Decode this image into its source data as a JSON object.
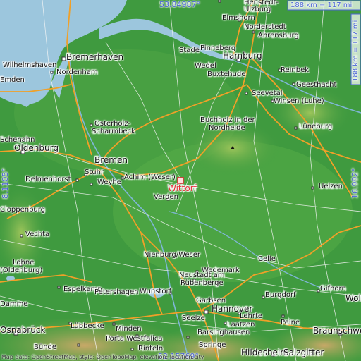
{
  "map": {
    "coords": {
      "top_lat": "53.84987°",
      "bottom_lat": "52.15769°",
      "left_lon": "8.1105°",
      "right_lon": "10.992°",
      "scale_h": "188 km = 117 mi",
      "scale_v": "188 km = 117 mi"
    },
    "highlight": {
      "name": "Wittorf"
    },
    "places": [
      {
        "name": "Elmshorn"
      },
      {
        "name": "Ulzburg"
      },
      {
        "name": "Henstedt-"
      },
      {
        "name": "Norderstedt"
      },
      {
        "name": "Ahrensburg"
      },
      {
        "name": "Stade"
      },
      {
        "name": "Pinneberg"
      },
      {
        "name": "Hamburg"
      },
      {
        "name": "Bremerhaven"
      },
      {
        "name": "Wilhelmshaven"
      },
      {
        "name": "Nordenham"
      },
      {
        "name": "Wedel"
      },
      {
        "name": "Buxtehude"
      },
      {
        "name": "Reinbek"
      },
      {
        "name": "Geesthacht"
      },
      {
        "name": "Seevetal"
      },
      {
        "name": "Winsen (Luhe)"
      },
      {
        "name": "Osterholz-"
      },
      {
        "name": "Scharmbeck"
      },
      {
        "name": "Buchholz in der"
      },
      {
        "name": "Nordheide"
      },
      {
        "name": "Lüneburg"
      },
      {
        "name": "Oldenburg"
      },
      {
        "name": "Bremen"
      },
      {
        "name": "Stuhr"
      },
      {
        "name": "Delmenhorst"
      },
      {
        "name": "Weyhe"
      },
      {
        "name": "Achim (Weser)"
      },
      {
        "name": "Uelzen"
      },
      {
        "name": "Verden"
      },
      {
        "name": "Vechta"
      },
      {
        "name": "Nienburg/Weser"
      },
      {
        "name": "Celle"
      },
      {
        "name": "Wedemark"
      },
      {
        "name": "Neustadt am"
      },
      {
        "name": "Rübenberge"
      },
      {
        "name": "Lohne"
      },
      {
        "name": "(Oldenburg)"
      },
      {
        "name": "Espelkamp"
      },
      {
        "name": "Petershagen"
      },
      {
        "name": "Wunstorf"
      },
      {
        "name": "Garbsen"
      },
      {
        "name": "Hannover"
      },
      {
        "name": "Burgdorf"
      },
      {
        "name": "Gifhorn"
      },
      {
        "name": "Wolfsburg"
      },
      {
        "name": "Lübbecke"
      },
      {
        "name": "Minden"
      },
      {
        "name": "Seelze"
      },
      {
        "name": "Lehrte"
      },
      {
        "name": "Peine"
      },
      {
        "name": "Osnabrück"
      },
      {
        "name": "Porta Westfalica"
      },
      {
        "name": "Laatzen"
      },
      {
        "name": "Barsinghausen"
      },
      {
        "name": "Springe"
      },
      {
        "name": "Rinteln"
      },
      {
        "name": "Bünde"
      },
      {
        "name": "Hildesheim"
      },
      {
        "name": "Salzgitter"
      },
      {
        "name": "Braunschweig"
      },
      {
        "name": "Cloppenburg"
      },
      {
        "name": "Damme"
      },
      {
        "name": "Emden"
      },
      {
        "name": "Schenahn"
      }
    ],
    "credit": "Map data: OpenStreetMap, style: OpenTopoMap, elevation: location.city"
  },
  "colors": {
    "sea": "#9cc6dd",
    "land": "#3f9a3f",
    "road_major": "#f0a028",
    "road_minor": "#f2f2f2",
    "highlight": "#e8303a",
    "coord_text": "#4a63d6"
  }
}
